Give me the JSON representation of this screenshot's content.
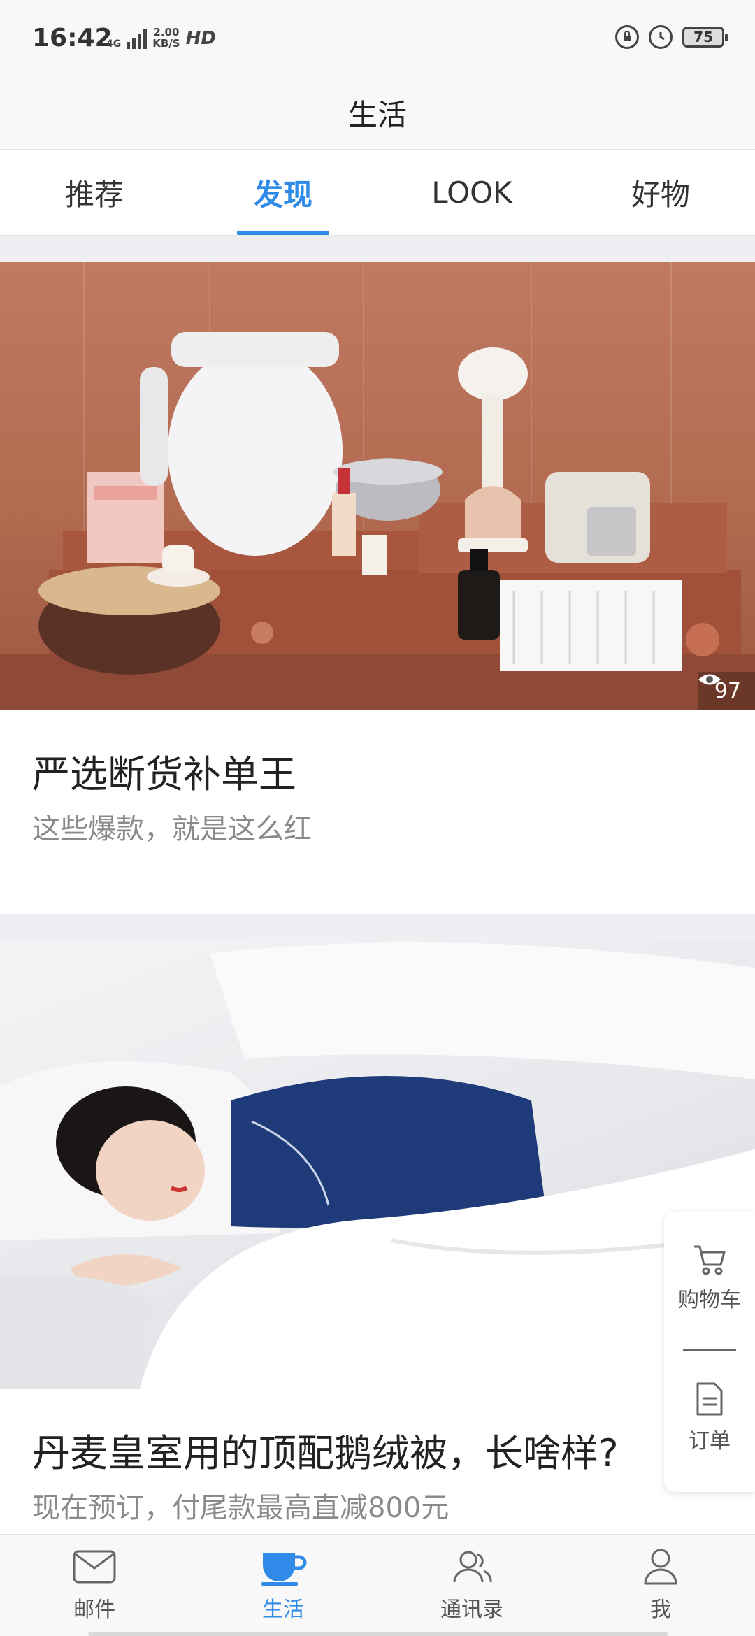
{
  "status_bar": {
    "time": "16:42",
    "network": "4G",
    "speed_top": "2.00",
    "speed_bottom": "KB/S",
    "hd": "HD",
    "battery": "75"
  },
  "header": {
    "title": "生活"
  },
  "tabs": [
    {
      "label": "推荐",
      "active": false
    },
    {
      "label": "发现",
      "active": true
    },
    {
      "label": "LOOK",
      "active": false
    },
    {
      "label": "好物",
      "active": false
    }
  ],
  "feed": [
    {
      "title": "严选断货补单王",
      "subtitle": "这些爆款，就是这么红",
      "views": "97",
      "image": "product-collage-toilet-seat-steamer-toaster-basket"
    },
    {
      "title": "丹麦皇室用的顶配鹅绒被，长啥样?",
      "subtitle": "现在预订，付尾款最高直减800元",
      "image": "woman-sleeping-under-down-duvet"
    }
  ],
  "side_panel": {
    "cart_label": "购物车",
    "orders_label": "订单"
  },
  "bottom_nav": [
    {
      "label": "邮件",
      "icon": "mail-icon",
      "active": false
    },
    {
      "label": "生活",
      "icon": "cup-icon",
      "active": true
    },
    {
      "label": "通讯录",
      "icon": "contacts-icon",
      "active": false
    },
    {
      "label": "我",
      "icon": "profile-icon",
      "active": false
    }
  ],
  "colors": {
    "accent": "#2f8ae8",
    "text_primary": "#222222",
    "text_secondary": "#8a8a8a",
    "feed_background": "#efeff3"
  }
}
